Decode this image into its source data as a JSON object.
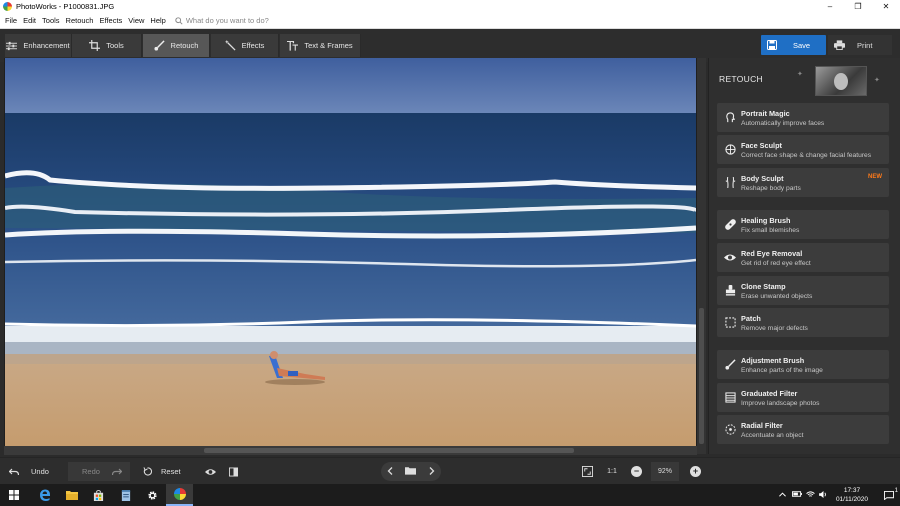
{
  "window": {
    "title": "PhotoWorks - P1000831.JPG",
    "controls": [
      "–",
      "❐",
      "✕"
    ]
  },
  "menu": {
    "items": [
      "File",
      "Edit",
      "Tools",
      "Retouch",
      "Effects",
      "View",
      "Help"
    ],
    "search_placeholder": "What do you want to do?"
  },
  "toolbar": {
    "tabs": [
      {
        "label": "Enhancement",
        "icon": "sliders-icon"
      },
      {
        "label": "Tools",
        "icon": "crop-icon"
      },
      {
        "label": "Retouch",
        "icon": "brush-icon",
        "active": true
      },
      {
        "label": "Effects",
        "icon": "magic-wand-icon"
      },
      {
        "label": "Text & Frames",
        "icon": "text-icon"
      }
    ],
    "save_label": "Save",
    "print_label": "Print"
  },
  "panel": {
    "title": "RETOUCH",
    "groups": [
      [
        {
          "name": "Portrait Magic",
          "desc": "Automatically improve faces",
          "icon": "portrait-magic-icon"
        },
        {
          "name": "Face Sculpt",
          "desc": "Correct face shape & change facial features",
          "icon": "face-sculpt-icon"
        },
        {
          "name": "Body Sculpt",
          "desc": "Reshape body parts",
          "icon": "body-sculpt-icon",
          "badge": "NEW"
        }
      ],
      [
        {
          "name": "Healing Brush",
          "desc": "Fix small blemishes",
          "icon": "bandage-icon"
        },
        {
          "name": "Red Eye Removal",
          "desc": "Get rid of red eye effect",
          "icon": "eye-icon"
        },
        {
          "name": "Clone Stamp",
          "desc": "Erase unwanted objects",
          "icon": "stamp-icon"
        },
        {
          "name": "Patch",
          "desc": "Remove major defects",
          "icon": "patch-icon"
        }
      ],
      [
        {
          "name": "Adjustment Brush",
          "desc": "Enhance parts of the image",
          "icon": "brush-icon"
        },
        {
          "name": "Graduated Filter",
          "desc": "Improve landscape photos",
          "icon": "graduated-filter-icon"
        },
        {
          "name": "Radial Filter",
          "desc": "Accentuate an object",
          "icon": "radial-filter-icon"
        }
      ]
    ]
  },
  "bottom": {
    "undo_label": "Undo",
    "redo_label": "Redo",
    "reset_label": "Reset",
    "ratio_label": "1:1",
    "zoom_value": "92%"
  },
  "taskbar": {
    "time": "17:37",
    "date": "01/11/2020",
    "notification_count": "1"
  },
  "colors": {
    "accent": "#1f6fc5",
    "badge": "#ff7a1a",
    "panel_bg": "#2f2f2f",
    "item_bg": "#3c3c3c"
  }
}
